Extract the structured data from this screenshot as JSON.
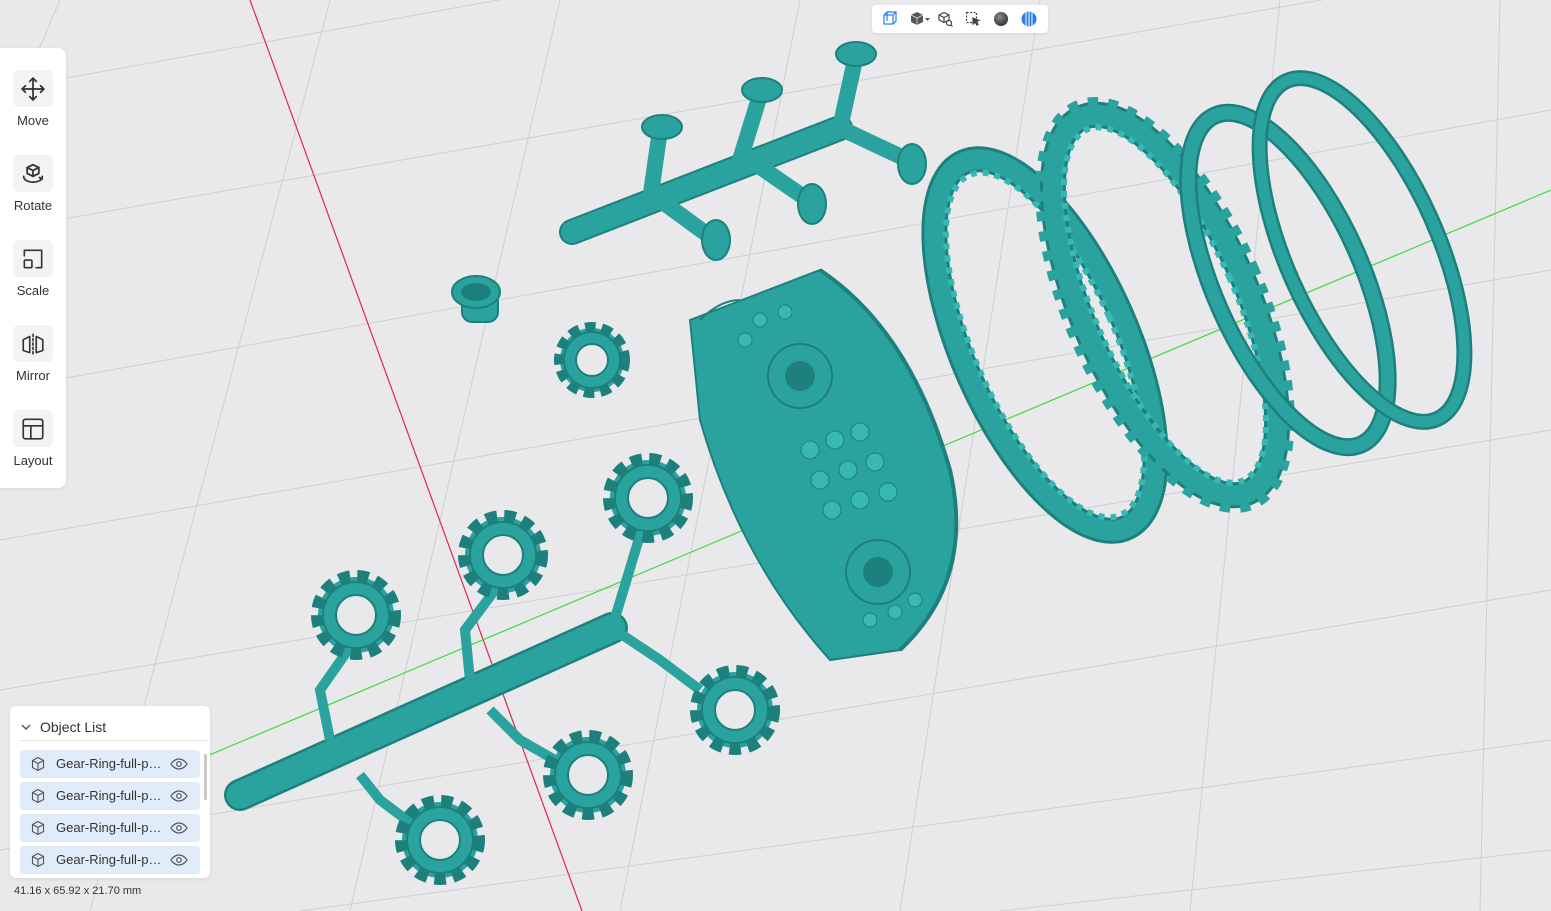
{
  "toolbar": {
    "tools": [
      {
        "label": "Move",
        "icon": "move-icon"
      },
      {
        "label": "Rotate",
        "icon": "rotate-icon"
      },
      {
        "label": "Scale",
        "icon": "scale-icon"
      },
      {
        "label": "Mirror",
        "icon": "mirror-icon"
      },
      {
        "label": "Layout",
        "icon": "layout-icon"
      }
    ]
  },
  "view_toolbar": {
    "icons": [
      "perspective-view-icon",
      "standard-view-dropdown-icon",
      "fit-view-icon",
      "select-region-icon",
      "shading-sphere-icon",
      "render-mode-icon"
    ]
  },
  "object_list": {
    "title": "Object List",
    "items": [
      {
        "name": "Gear-Ring-full-parts"
      },
      {
        "name": "Gear-Ring-full-parts"
      },
      {
        "name": "Gear-Ring-full-parts"
      },
      {
        "name": "Gear-Ring-full-parts"
      }
    ]
  },
  "status": {
    "dimensions": "41.16 x 65.92 x 21.70 mm"
  },
  "colors": {
    "model": "#2aa39f",
    "model_dark": "#1d807d",
    "background": "#e9e9eb",
    "grid": "#cfcfd2",
    "x_axis": "#e0245e",
    "y_axis": "#3ddc3d",
    "selection": "#e1ecfa"
  }
}
